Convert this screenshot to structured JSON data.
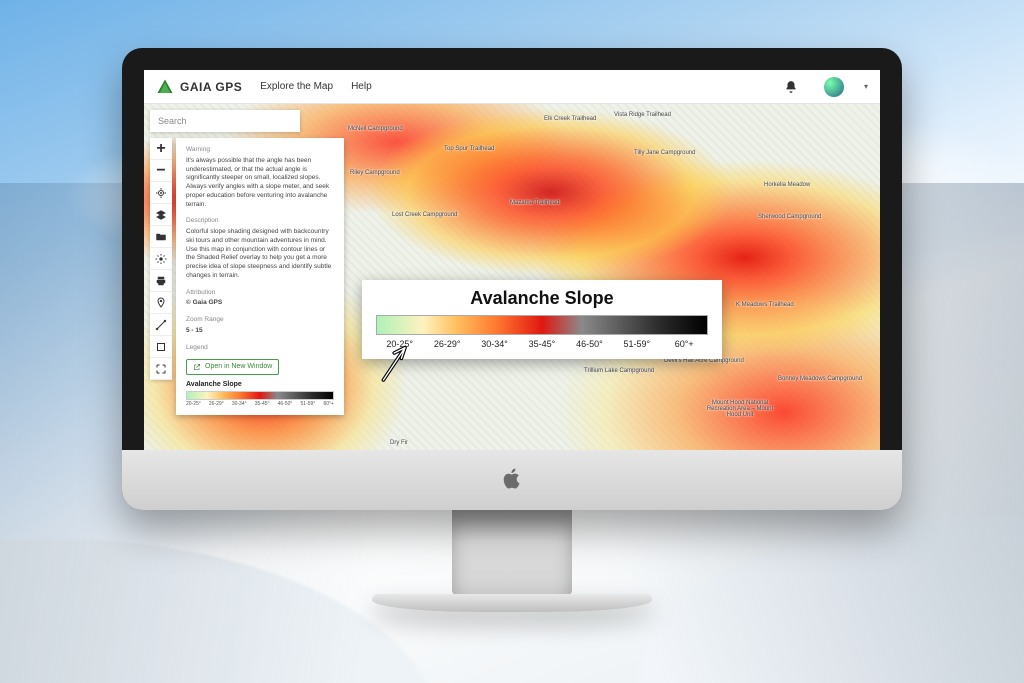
{
  "header": {
    "brand": "GAIA GPS",
    "nav": {
      "explore": "Explore the Map",
      "help": "Help"
    }
  },
  "search": {
    "placeholder": "Search"
  },
  "tools": {
    "zoom_in": "+",
    "zoom_out": "−"
  },
  "panel": {
    "warning_heading": "Warning",
    "warning_body": "It's always possible that the angle has been underestimated, or that the actual angle is significantly steeper on small, localized slopes. Always verify angles with a slope meter, and seek proper education before venturing into avalanche terrain.",
    "description_heading": "Description",
    "description_body": "Colorful slope shading designed with backcountry ski tours and other mountain adventures in mind. Use this map in conjunction with contour lines or the Shaded Relief overlay to help you get a more precise idea of slope steepness and identify subtle changes in terrain.",
    "attribution_heading": "Attribution",
    "attribution_body": "© Gaia GPS",
    "zoom_heading": "Zoom Range",
    "zoom_body": "5 - 15",
    "legend_heading": "Legend",
    "open_new": "Open in New Window",
    "legend_title": "Avalanche Slope"
  },
  "legend": {
    "title": "Avalanche Slope",
    "ranges": [
      "20-25°",
      "26-29°",
      "30-34°",
      "35-45°",
      "46-50°",
      "51-59°",
      "60°+"
    ]
  },
  "map_labels": {
    "elk": "Elk Creek Trailhead",
    "vista": "Vista Ridge Trailhead",
    "topspur": "Top Spur Trailhead",
    "tilly": "Tilly Jane Campground",
    "mazama": "Mazama Trailhead",
    "lostcreek": "Lost Creek Campground",
    "horkelia": "Horkelia Meadow",
    "sherwood": "Sherwood Campground",
    "rileycg": "Riley Campground",
    "mcneil": "McNeil Campground",
    "kmeadows": "K Meadows Trailhead",
    "trillium": "Trillium Lake Campground",
    "devils": "Devil's Half Acre Campground",
    "bonney": "Bonney Meadows Campground",
    "mthood": "Mount Hood National Recreation Area – Mount Hood Unit",
    "dryfir": "Dry Fir"
  }
}
